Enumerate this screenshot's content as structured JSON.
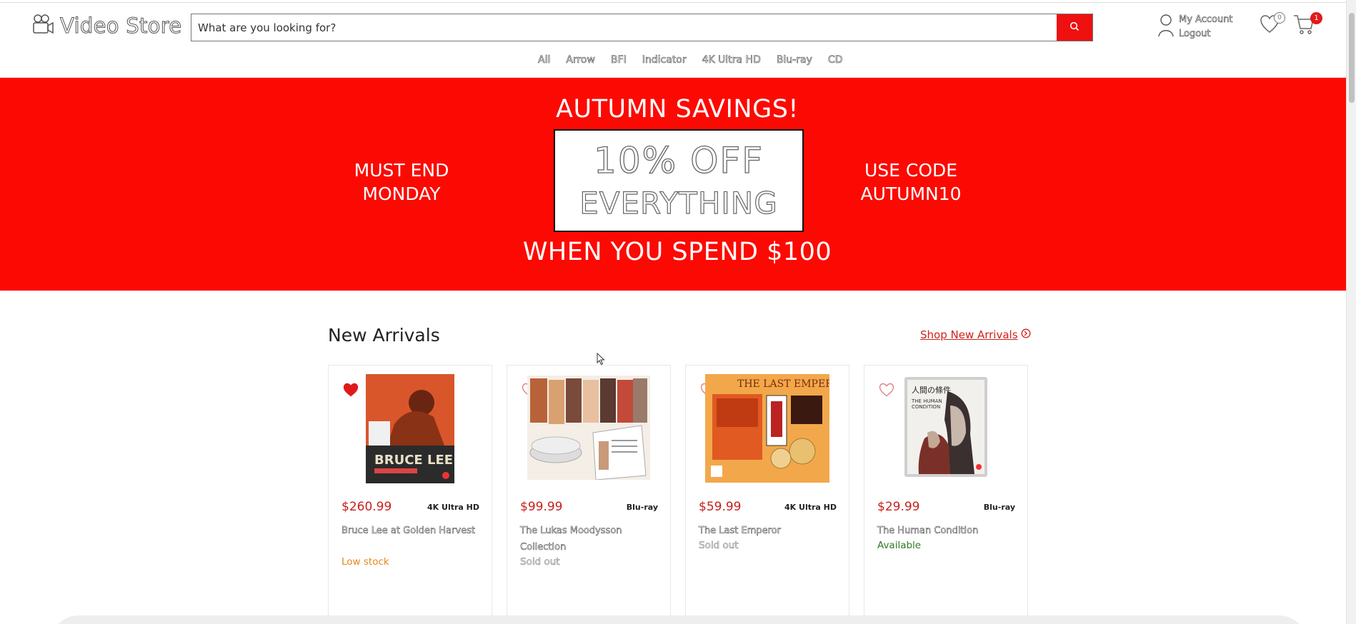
{
  "header": {
    "logo_text": "Video Store",
    "search_placeholder": "What are you looking for?",
    "account_label": "My Account",
    "logout_label": "Logout",
    "wishlist_count": "0",
    "cart_count": "1"
  },
  "nav": {
    "items": [
      "All",
      "Arrow",
      "BFI",
      "Indicator",
      "4K Ultra HD",
      "Blu-ray",
      "CD"
    ]
  },
  "banner": {
    "headline": "AUTUMN SAVINGS!",
    "left_line1": "MUST END",
    "left_line2": "MONDAY",
    "box_line1": "10% OFF",
    "box_line2": "EVERYTHING",
    "right_line1": "USE CODE",
    "right_line2": "AUTUMN10",
    "bottom": "WHEN YOU SPEND $100",
    "color": "#fd0903"
  },
  "section": {
    "title": "New Arrivals",
    "link": "Shop New Arrivals"
  },
  "products": [
    {
      "price": "$260.99",
      "format": "4K Ultra HD",
      "title": "Bruce Lee at Golden Harvest",
      "stock": "Low stock",
      "favorited": true
    },
    {
      "price": "$99.99",
      "format": "Blu-ray",
      "title": "The Lukas Moodysson Collection",
      "stock": "Sold out",
      "favorited": false
    },
    {
      "price": "$59.99",
      "format": "4K Ultra HD",
      "title": "The Last Emperor",
      "stock": "Sold out",
      "favorited": false
    },
    {
      "price": "$29.99",
      "format": "Blu-ray",
      "title": "The Human Condition",
      "stock": "Available",
      "favorited": false
    }
  ],
  "colors": {
    "accent": "#ef1010",
    "price": "#c8201a",
    "low_stock": "#e8861c",
    "available": "#2f7a27"
  }
}
